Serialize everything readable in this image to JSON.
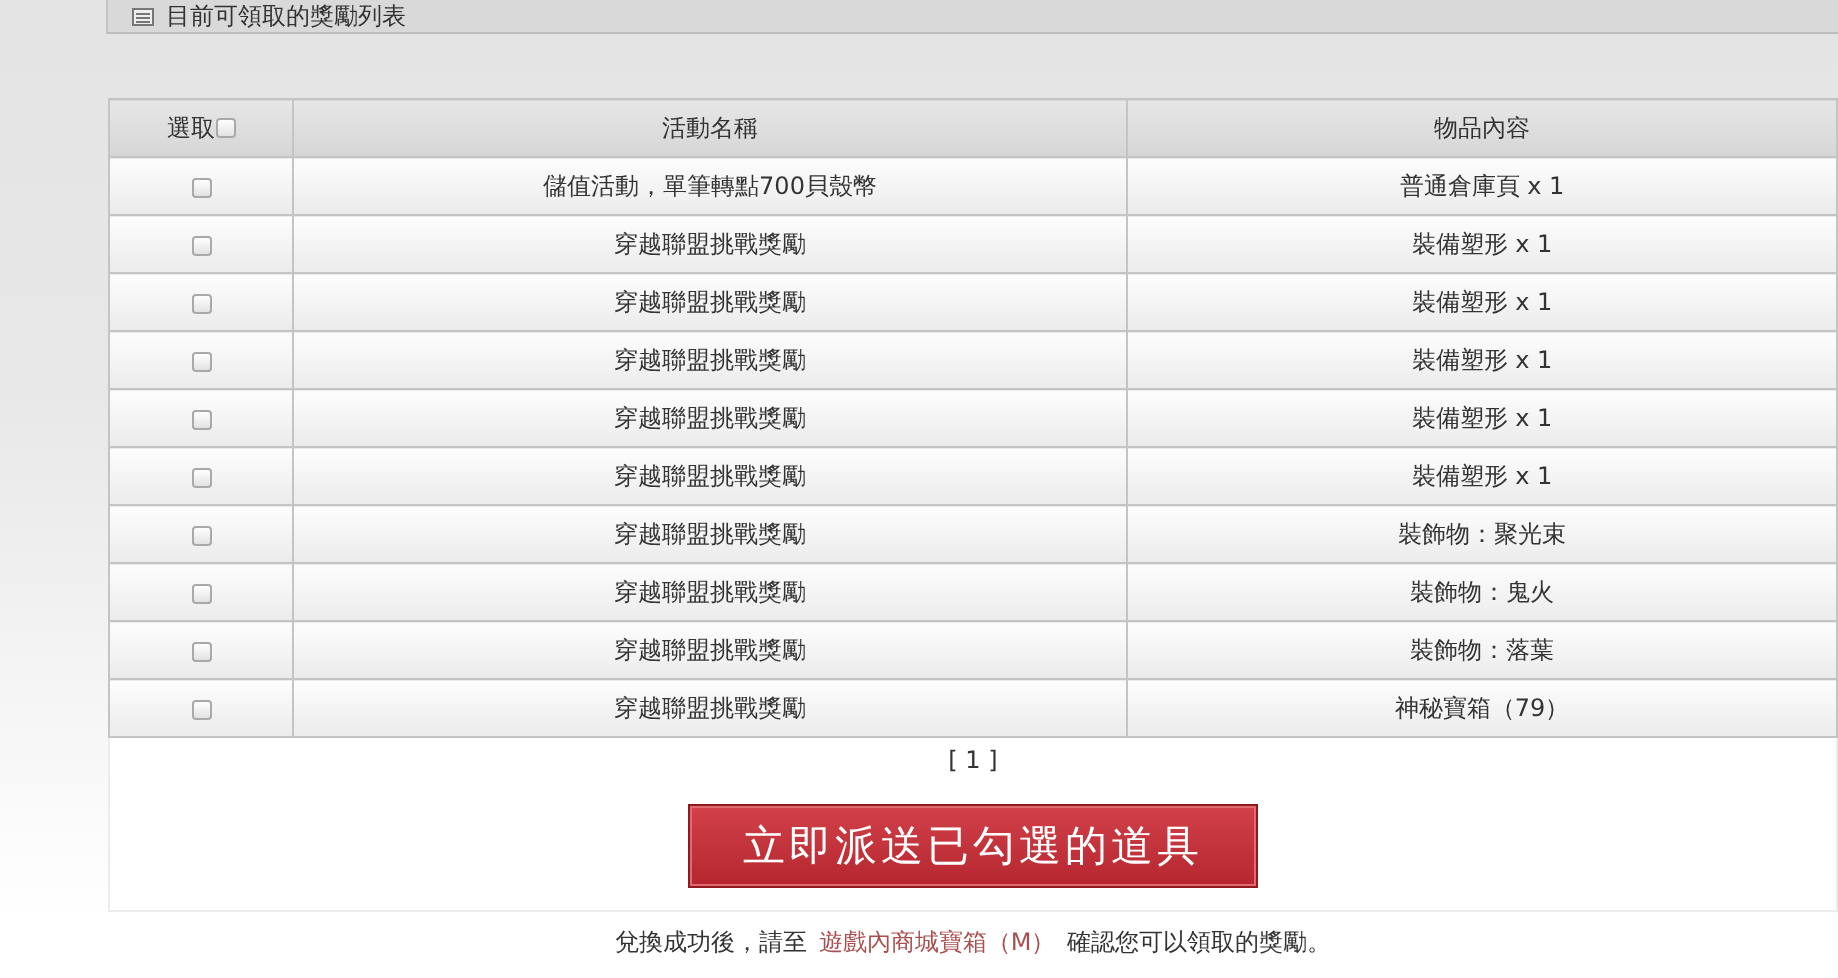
{
  "section_title": "目前可領取的獎勵列表",
  "table": {
    "columns": [
      "選取",
      "活動名稱",
      "物品內容"
    ],
    "select_all_checked": false,
    "rows": [
      {
        "checked": false,
        "activity": "儲值活動，單筆轉點700貝殼幣",
        "item": "普通倉庫頁 x 1"
      },
      {
        "checked": false,
        "activity": "穿越聯盟挑戰獎勵",
        "item": "裝備塑形 x 1"
      },
      {
        "checked": false,
        "activity": "穿越聯盟挑戰獎勵",
        "item": "裝備塑形 x 1"
      },
      {
        "checked": false,
        "activity": "穿越聯盟挑戰獎勵",
        "item": "裝備塑形 x 1"
      },
      {
        "checked": false,
        "activity": "穿越聯盟挑戰獎勵",
        "item": "裝備塑形 x 1"
      },
      {
        "checked": false,
        "activity": "穿越聯盟挑戰獎勵",
        "item": "裝備塑形 x 1"
      },
      {
        "checked": false,
        "activity": "穿越聯盟挑戰獎勵",
        "item": "裝飾物：聚光束"
      },
      {
        "checked": false,
        "activity": "穿越聯盟挑戰獎勵",
        "item": "裝飾物：鬼火"
      },
      {
        "checked": false,
        "activity": "穿越聯盟挑戰獎勵",
        "item": "裝飾物：落葉"
      },
      {
        "checked": false,
        "activity": "穿越聯盟挑戰獎勵",
        "item": "神秘寶箱（79）"
      }
    ]
  },
  "pager": "[ 1 ]",
  "send_button": "立即派送已勾選的道具",
  "footer": {
    "before": "兌換成功後，請至",
    "link": "遊戲內商城寶箱（M）",
    "after": "確認您可以領取的獎勵。"
  }
}
